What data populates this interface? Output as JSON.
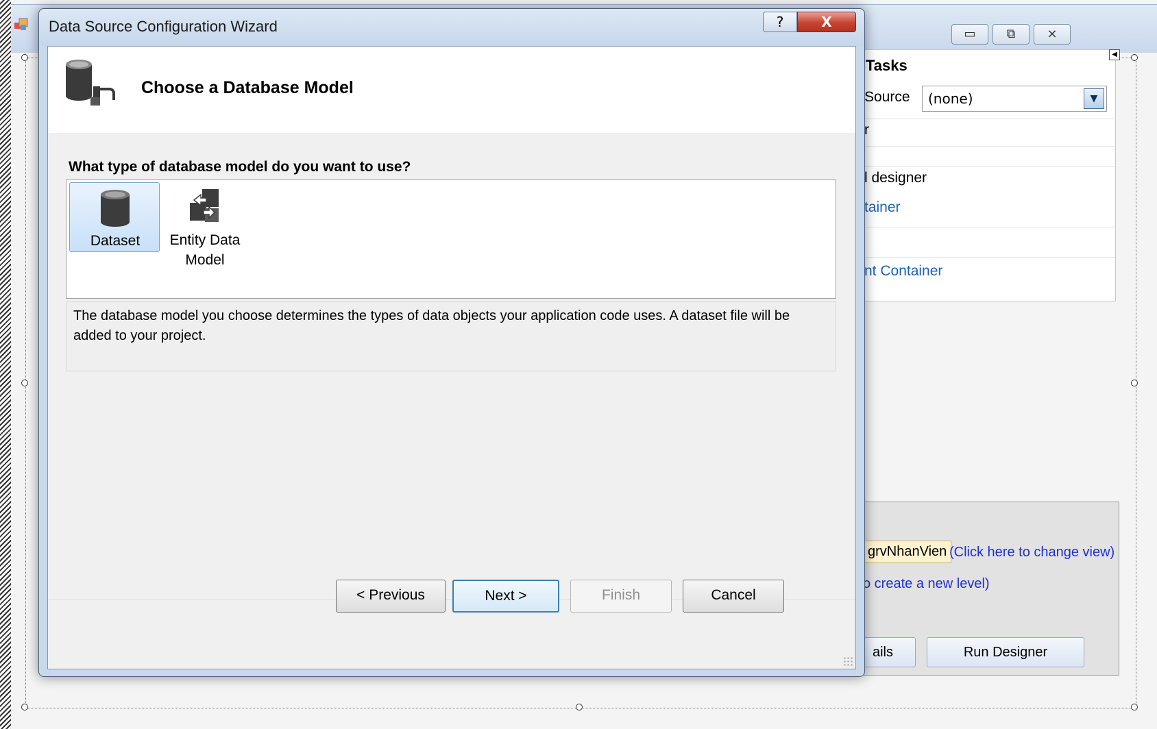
{
  "dialog": {
    "title": "Data Source Configuration Wizard",
    "help_label": "?",
    "close_label": "X",
    "header_title": "Choose a Database Model",
    "question": "What type of database model do you want to use?",
    "models": [
      {
        "label": "Dataset",
        "selected": true
      },
      {
        "label": "Entity Data Model",
        "selected": false
      }
    ],
    "description": "The database model you choose determines the types of data objects your application code uses. A dataset file will be added to your project.",
    "buttons": {
      "previous": "< Previous",
      "next": "Next >",
      "finish": "Finish",
      "cancel": "Cancel"
    }
  },
  "background": {
    "window_buttons": {
      "minimize": "▭",
      "maximize": "⧉",
      "close": "⨯"
    },
    "tasks_title": "Tasks",
    "data_source_label": "Source",
    "data_source_value": "(none)",
    "task_items": [
      {
        "text": "r",
        "link": false
      },
      {
        "text": "l designer",
        "link": false
      },
      {
        "text": "tainer",
        "link": true
      },
      {
        "text": "nt Container",
        "link": true
      }
    ],
    "level_tag": "grvNhanVien",
    "change_view_link": "(Click here to change view)",
    "new_level_link": "o create a new level)",
    "details_button": "ails",
    "run_designer_button": "Run Designer"
  },
  "colors": {
    "accent": "#3c7fb1",
    "link": "#1b63b6",
    "close_red": "#c7432f"
  }
}
